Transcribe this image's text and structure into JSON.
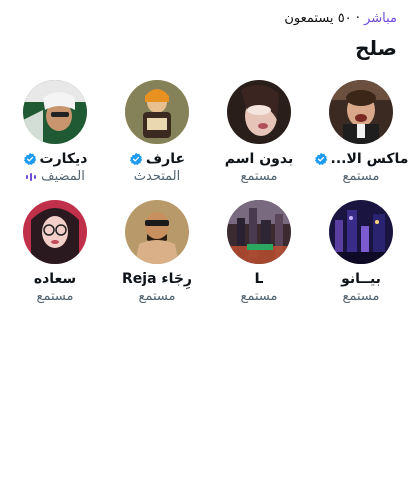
{
  "header": {
    "live_label": "مباشر",
    "separator": "·",
    "listener_count": "٥٠ يستمعون"
  },
  "space": {
    "title": "صلح"
  },
  "participants": [
    {
      "name": "ماكس الا...",
      "role": "مستمع",
      "verified": true,
      "avatar": "avatar-max"
    },
    {
      "name": "بدون اسم",
      "role": "مستمع",
      "verified": false,
      "avatar": "avatar-noname"
    },
    {
      "name": "عارف",
      "role": "المتحدث",
      "verified": true,
      "avatar": "avatar-aref"
    },
    {
      "name": "ديكارت",
      "role": "المضيف",
      "verified": true,
      "avatar": "avatar-descartes",
      "speaking": true
    },
    {
      "name": "بيــانو",
      "role": "مستمع",
      "verified": false,
      "avatar": "avatar-piano"
    },
    {
      "name": "L",
      "role": "مستمع",
      "verified": false,
      "avatar": "avatar-l"
    },
    {
      "name": "رِجَاء Reja",
      "role": "مستمع",
      "verified": false,
      "avatar": "avatar-reja"
    },
    {
      "name": "سعاده",
      "role": "مستمع",
      "verified": false,
      "avatar": "avatar-saada"
    }
  ],
  "colors": {
    "verified_badge": "#1d9bf0",
    "live_accent": "#6e4bd8",
    "secondary_text": "#536471"
  }
}
